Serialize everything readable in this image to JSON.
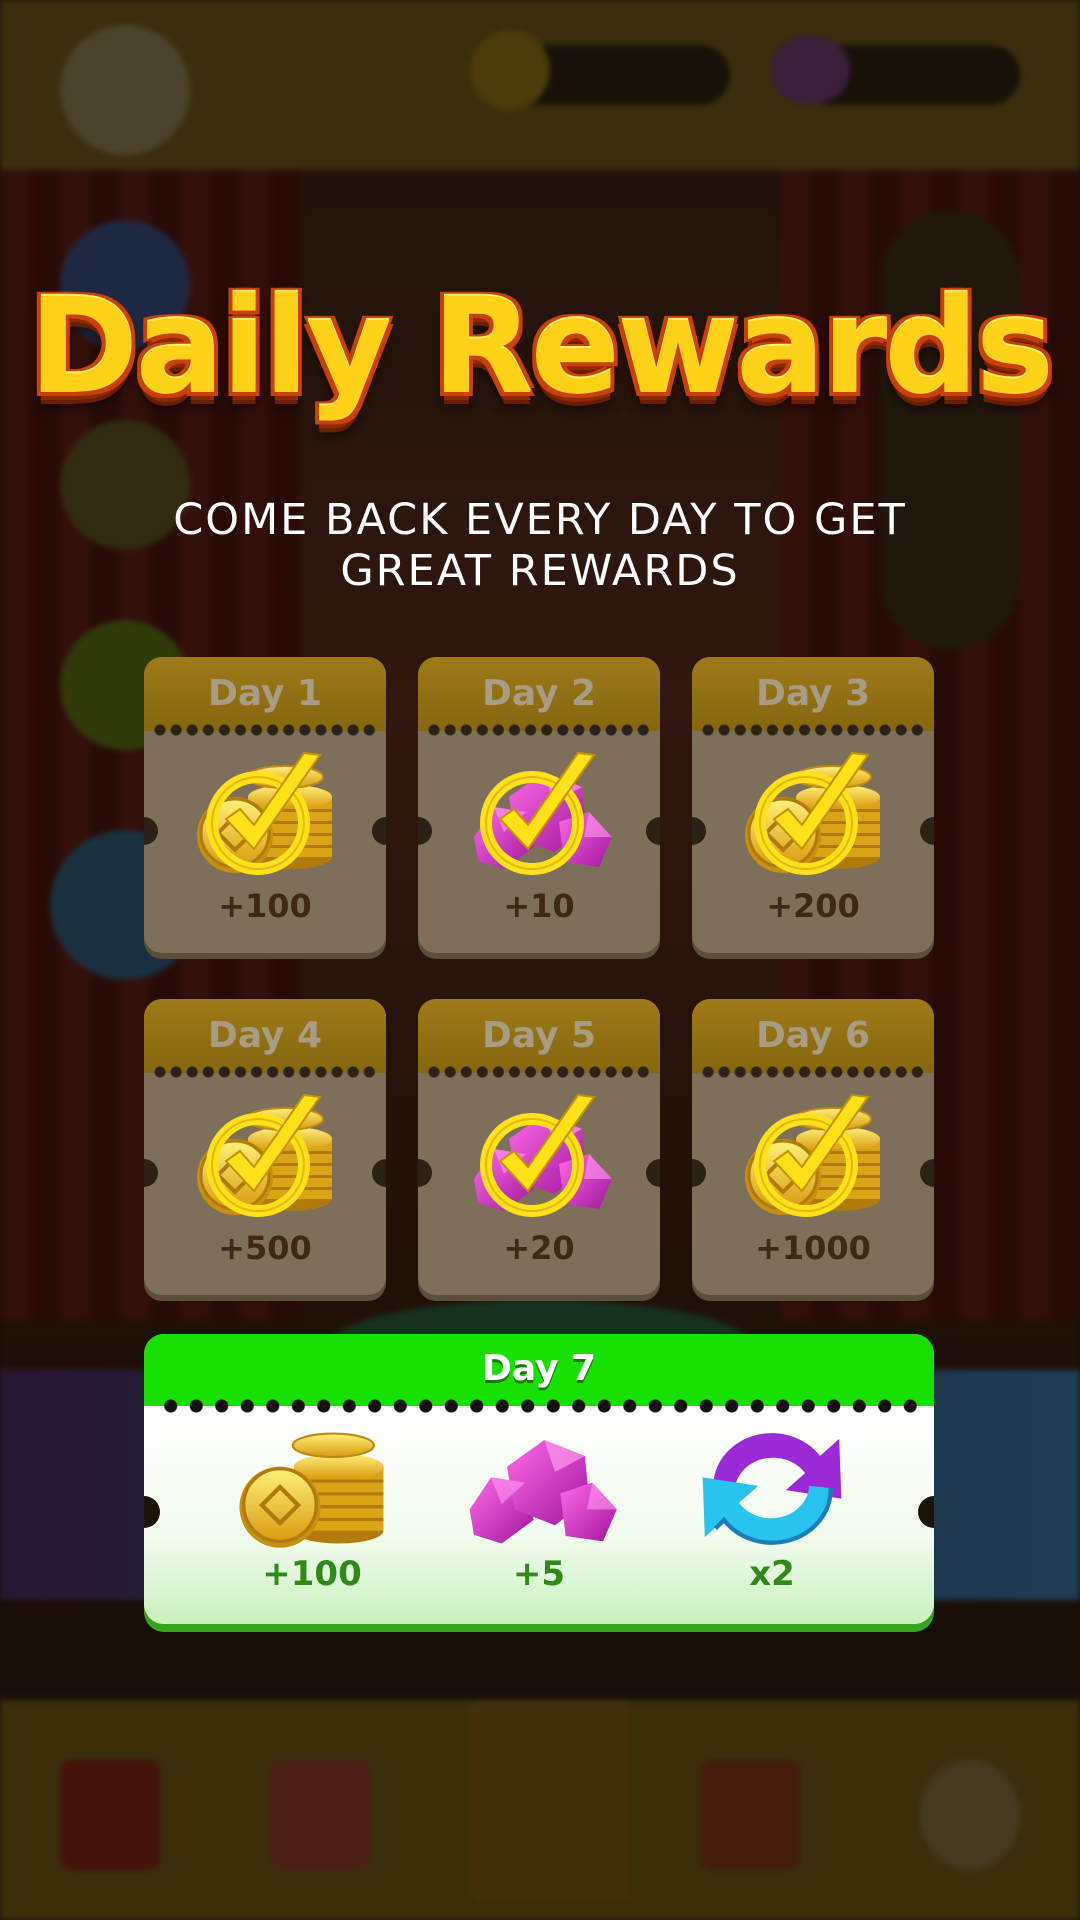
{
  "popup": {
    "title": "Daily Rewards",
    "subtitle": "COME BACK EVERY DAY TO GET GREAT REWARDS"
  },
  "days": [
    {
      "label": "Day 1",
      "reward": "coins",
      "icon": "coin-stack-icon",
      "amount": "+100",
      "claimed": true
    },
    {
      "label": "Day 2",
      "reward": "gems",
      "icon": "gem-cluster-icon",
      "amount": "+10",
      "claimed": true
    },
    {
      "label": "Day 3",
      "reward": "coins",
      "icon": "coin-stack-icon",
      "amount": "+200",
      "claimed": true
    },
    {
      "label": "Day 4",
      "reward": "coins",
      "icon": "coin-stack-icon",
      "amount": "+500",
      "claimed": true
    },
    {
      "label": "Day 5",
      "reward": "gems",
      "icon": "gem-cluster-icon",
      "amount": "+20",
      "claimed": true
    },
    {
      "label": "Day 6",
      "reward": "coins",
      "icon": "coin-stack-icon",
      "amount": "+1000",
      "claimed": true
    }
  ],
  "day7": {
    "label": "Day 7",
    "rewards": [
      {
        "reward": "coins",
        "icon": "coin-stack-icon",
        "amount": "+100"
      },
      {
        "reward": "gems",
        "icon": "gem-cluster-icon",
        "amount": "+5"
      },
      {
        "reward": "refresh",
        "icon": "refresh-arrows-icon",
        "amount": "x2"
      }
    ]
  },
  "colors": {
    "title_fill": "#ffd21a",
    "title_outline": "#c9400a",
    "claimed_card": "#7e6f5a",
    "day7_header": "#18e000",
    "day7_amount": "#2f8a18",
    "check": "#ffe11a",
    "gem": "#b21fb8",
    "coin": "#e8b51c"
  }
}
